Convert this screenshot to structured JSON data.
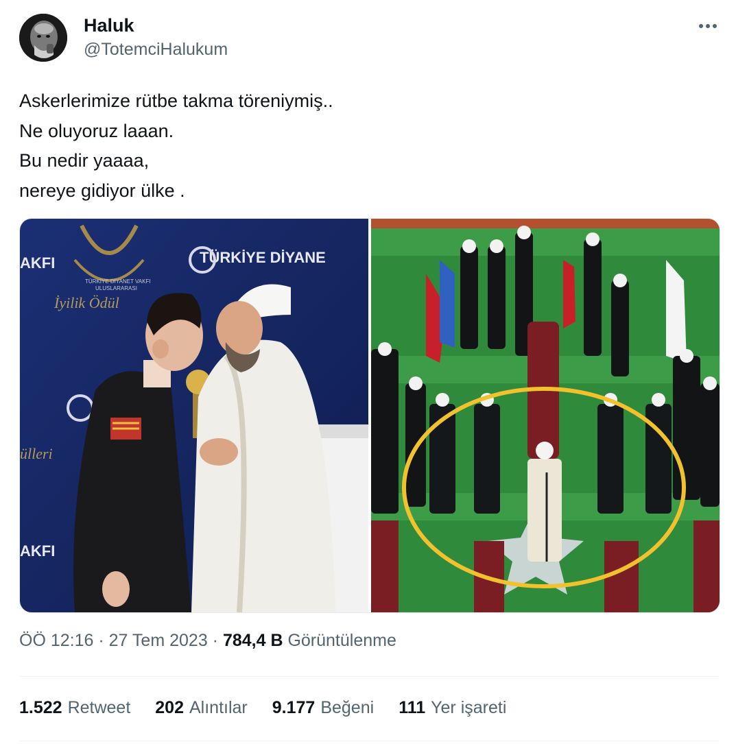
{
  "author": {
    "name": "Haluk",
    "handle": "@TotemciHalukum"
  },
  "tweet": {
    "lines": [
      "Askerlerimize rütbe takma töreniymiş..",
      "Ne oluyoruz laaan.",
      "Bu nedir yaaaa,",
      "nereye gidiyor ülke ."
    ]
  },
  "media": {
    "photo1_sign_texts": [
      "AKFI",
      "TÜRKİYE DİYANE",
      "İyilik Ödül",
      "AKFI",
      "TÜRKİYE DİYANET VAKFI",
      "ULUSLARARASI",
      "ülleri"
    ],
    "photo2_caption": ""
  },
  "meta": {
    "time": "ÖÖ 12:16",
    "date": "27 Tem 2023",
    "views_count": "784,4 B",
    "views_label": "Görüntülenme",
    "separator": " · "
  },
  "stats": [
    {
      "count": "1.522",
      "label": "Retweet"
    },
    {
      "count": "202",
      "label": "Alıntılar"
    },
    {
      "count": "9.177",
      "label": "Beğeni"
    },
    {
      "count": "111",
      "label": "Yer işareti"
    }
  ],
  "icons": {
    "more": "more-options-icon"
  },
  "colors": {
    "secondary_text": "#536471",
    "primary_text": "#0f1419",
    "highlight_circle": "#f2c12e"
  }
}
